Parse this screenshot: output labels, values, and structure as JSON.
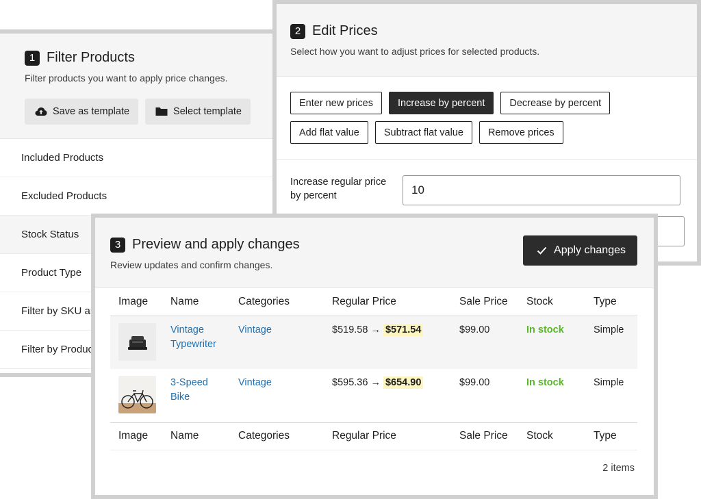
{
  "filter": {
    "step": "1",
    "title": "Filter Products",
    "subtitle": "Filter products you want to apply price changes.",
    "save_template_label": "Save as template",
    "select_template_label": "Select template",
    "rows": [
      "Included Products",
      "Excluded Products",
      "Stock Status",
      "Product Type",
      "Filter by SKU ar",
      "Filter by Produc"
    ]
  },
  "edit": {
    "step": "2",
    "title": "Edit Prices",
    "subtitle": "Select how you want to adjust prices for selected products.",
    "modes": [
      "Enter new prices",
      "Increase by percent",
      "Decrease by percent",
      "Add flat value",
      "Subtract flat value",
      "Remove prices"
    ],
    "active_mode": "Increase by percent",
    "regular_label": "Increase regular price by percent",
    "regular_value": "10"
  },
  "preview": {
    "step": "3",
    "title": "Preview and apply changes",
    "subtitle": "Review updates and confirm changes.",
    "apply_label": "Apply changes",
    "columns": [
      "Image",
      "Name",
      "Categories",
      "Regular Price",
      "Sale Price",
      "Stock",
      "Type"
    ],
    "rows": [
      {
        "name": "Vintage Typewriter",
        "category": "Vintage",
        "old_price": "$519.58 →",
        "new_price": "$571.54",
        "sale_price": "$99.00",
        "stock": "In stock",
        "type": "Simple"
      },
      {
        "name": "3-Speed Bike",
        "category": "Vintage",
        "old_price": "$595.36 →",
        "new_price": "$654.90",
        "sale_price": "$99.00",
        "stock": "In stock",
        "type": "Simple"
      }
    ],
    "items_count": "2 items"
  },
  "colors": {
    "accent_dark": "#2c2c2c",
    "link": "#2271b1",
    "in_stock": "#59b72a",
    "highlight": "#fcf5c0"
  }
}
